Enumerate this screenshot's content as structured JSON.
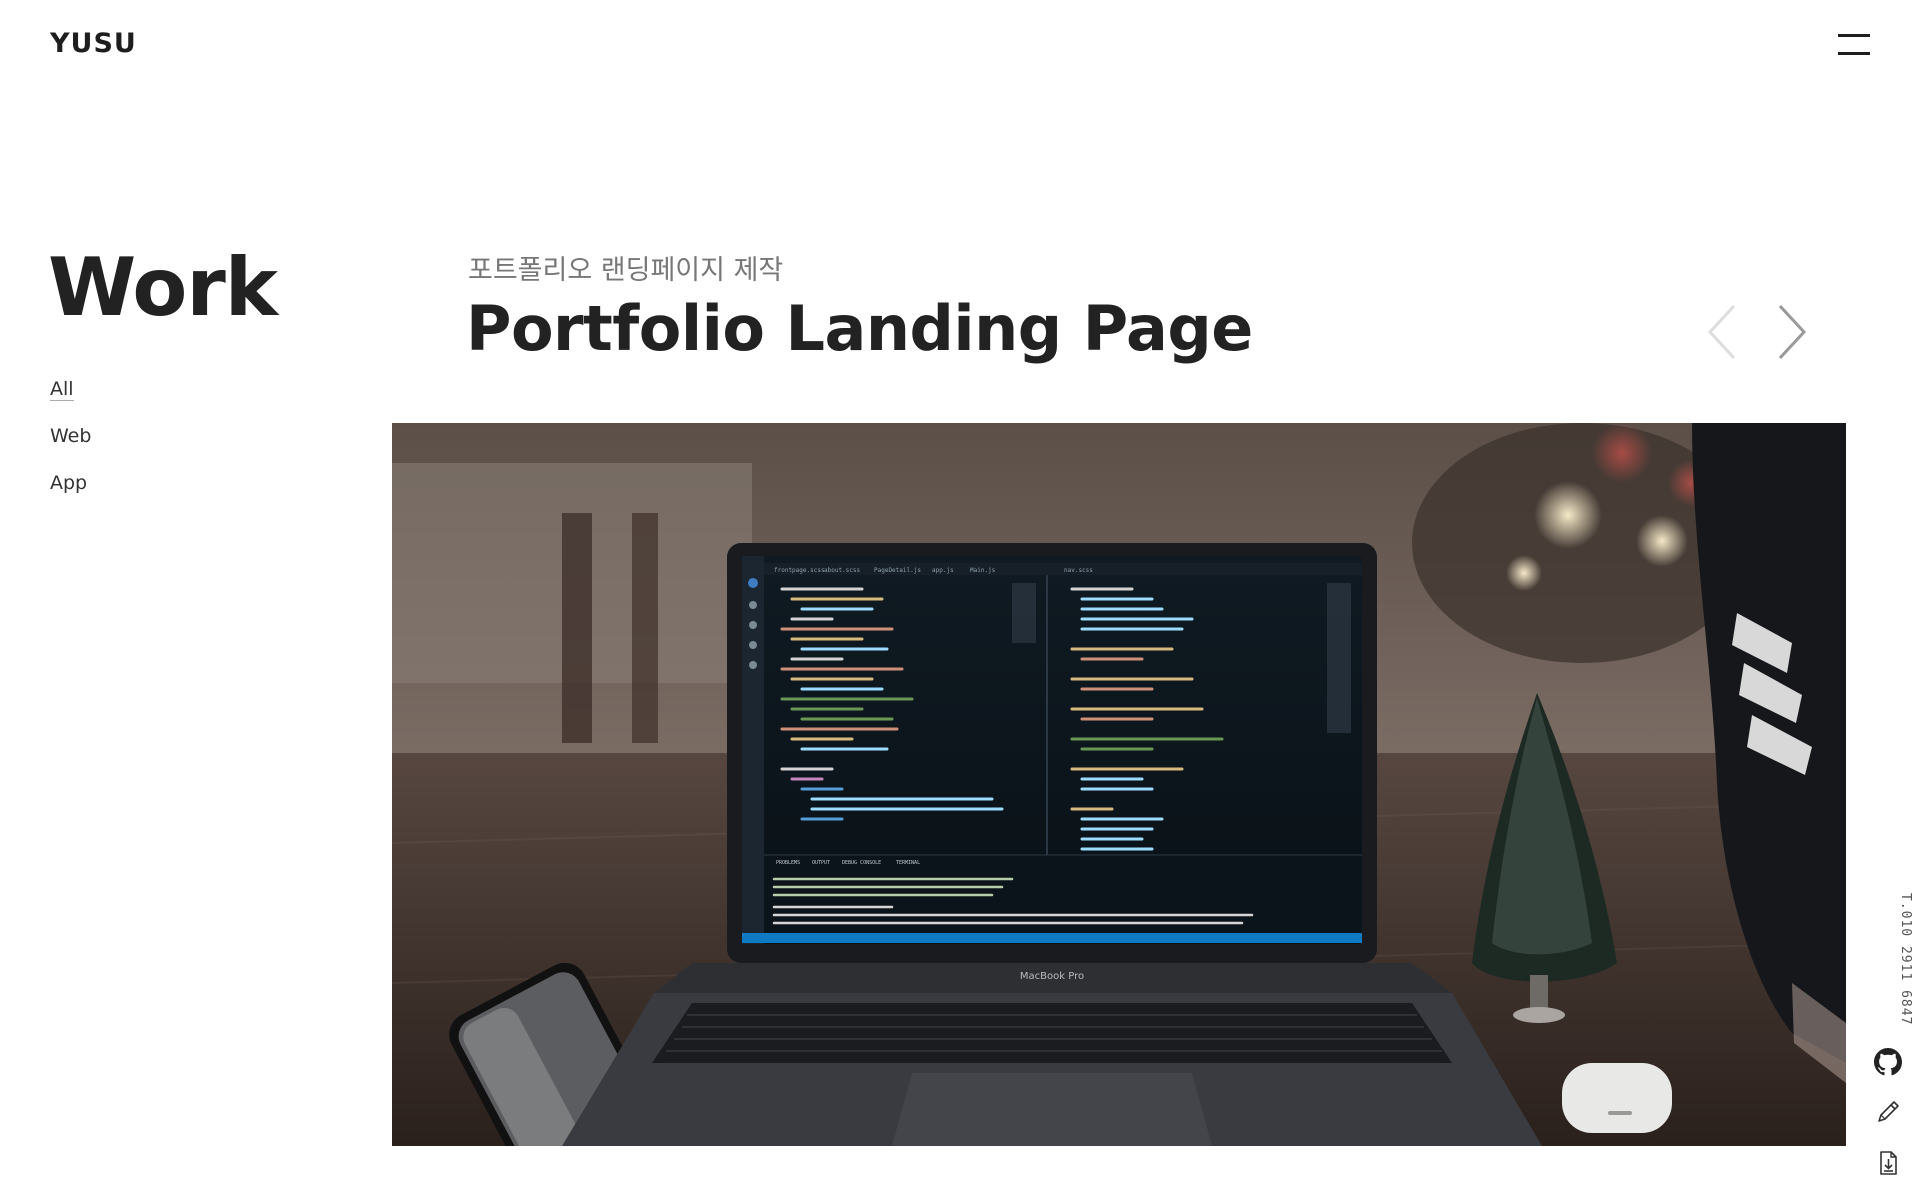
{
  "header": {
    "logo": "YUSU",
    "menu_icon": "hamburger-menu-icon"
  },
  "section": {
    "title": "Work",
    "filters": [
      {
        "label": "All",
        "active": true
      },
      {
        "label": "Web",
        "active": false
      },
      {
        "label": "App",
        "active": false
      }
    ]
  },
  "project": {
    "subtitle": "포트폴리오 랜딩페이지 제작",
    "title": "Portfolio Landing Page",
    "prev_icon": "chevron-left-icon",
    "next_icon": "chevron-right-icon",
    "image": {
      "laptop_label": "MacBook Pro",
      "code_tabs": [
        "frontpage.scss",
        "about.scss",
        "PageDetail.js",
        "app.js",
        "Main.js",
        "nav.scss"
      ],
      "terminal_tabs": [
        "PROBLEMS",
        "OUTPUT",
        "DEBUG CONSOLE",
        "TERMINAL"
      ]
    }
  },
  "sidebar": {
    "phone": "T.010 2911 6847",
    "icons": [
      "github-icon",
      "pencil-icon",
      "download-icon"
    ]
  },
  "colors": {
    "text_dark": "#222222",
    "text_muted": "#777777",
    "arrow_prev": "#dddddd",
    "arrow_next": "#9a9a9a"
  }
}
